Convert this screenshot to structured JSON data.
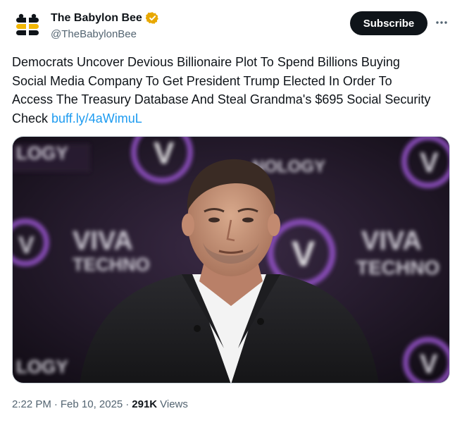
{
  "account": {
    "display_name": "The Babylon Bee",
    "handle": "@TheBabylonBee",
    "verified": true,
    "verified_color": "#f4b400"
  },
  "actions": {
    "subscribe_label": "Subscribe",
    "more_icon": "more-horizontal-icon"
  },
  "tweet": {
    "text": "Democrats Uncover Devious Billionaire Plot To Spend Billions Buying Social Media Company To Get President Trump Elected In Order To Access The Treasury Database And Steal Grandma's $695 Social Security Check ",
    "link": "buff.ly/4aWimuL"
  },
  "media": {
    "description_icon": "photo",
    "backdrop_texts": [
      "VIVA",
      "TECHNO",
      "VIVA",
      "TECHNO",
      "LOGY",
      "NOLOGY",
      "LOGY"
    ]
  },
  "meta": {
    "time": "2:22 PM",
    "separator": "·",
    "date": "Feb 10, 2025",
    "views_count": "291K",
    "views_label": "Views"
  },
  "colors": {
    "link": "#1d9bf0",
    "text": "#0f1419",
    "secondary": "#536471",
    "button_bg": "#0f1419",
    "backdrop_purple": "#6a2b9a"
  }
}
